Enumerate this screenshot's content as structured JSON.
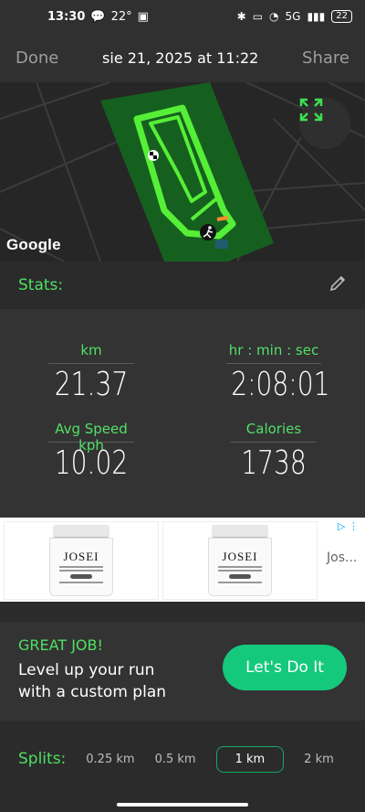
{
  "status": {
    "time": "13:30",
    "temp": "22°",
    "network": "5G",
    "battery": "22"
  },
  "header": {
    "done": "Done",
    "title": "sie 21, 2025 at 11:22",
    "share": "Share"
  },
  "map": {
    "attribution": "Google"
  },
  "stats_bar": {
    "label": "Stats:"
  },
  "stats": [
    {
      "label": "km",
      "value": "21.37"
    },
    {
      "label": "hr : min : sec",
      "value": "2:08:01"
    },
    {
      "label": "Avg Speed kph",
      "value": "10.02"
    },
    {
      "label": "Calories",
      "value": "1738"
    }
  ],
  "ad": {
    "brand": "JOSEI",
    "more_text": "Jos..."
  },
  "promo": {
    "headline": "GREAT JOB!",
    "text": "Level up your run with a custom plan",
    "cta": "Let's Do It"
  },
  "splits": {
    "label": "Splits:",
    "options": [
      "0.25 km",
      "0.5 km",
      "1 km",
      "2 km"
    ],
    "selected": "1 km"
  },
  "colors": {
    "accent": "#4ee061",
    "cta": "#14c97b",
    "route": "#5dff3a"
  }
}
